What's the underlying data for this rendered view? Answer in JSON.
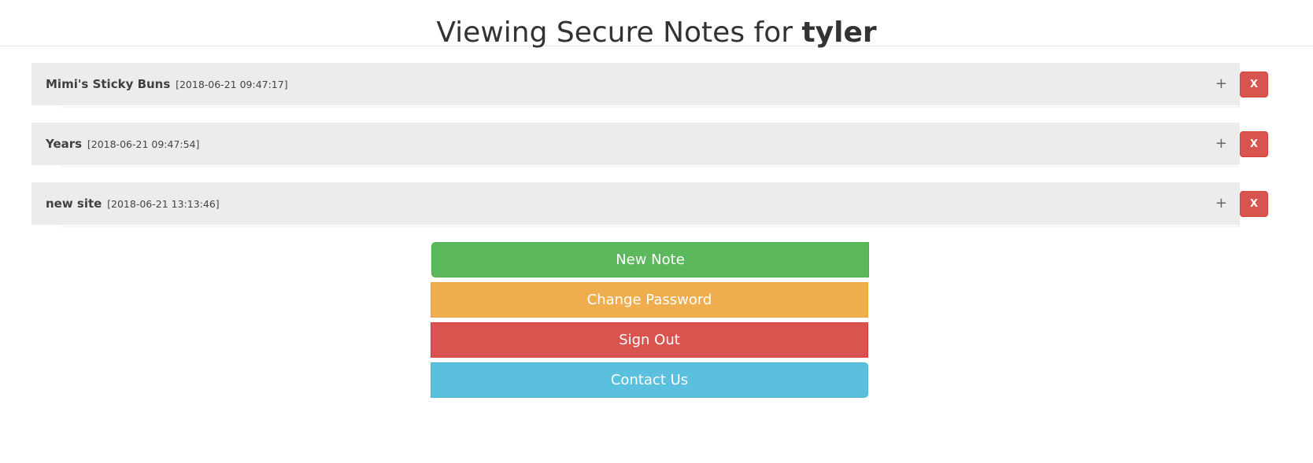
{
  "header": {
    "title_prefix": "Viewing Secure Notes for ",
    "username": "tyler"
  },
  "notes": [
    {
      "title": "Mimi's Sticky Buns",
      "date": "[2018-06-21 09:47:17]",
      "expand_icon": "+",
      "delete_label": "X"
    },
    {
      "title": "Years",
      "date": "[2018-06-21 09:47:54]",
      "expand_icon": "+",
      "delete_label": "X"
    },
    {
      "title": "new site",
      "date": "[2018-06-21 13:13:46]",
      "expand_icon": "+",
      "delete_label": "X"
    }
  ],
  "actions": {
    "new_note": "New Note",
    "change_password": "Change Password",
    "sign_out": "Sign Out",
    "contact_us": "Contact Us"
  },
  "colors": {
    "success": "#5cb85c",
    "warning": "#f0ad4e",
    "danger": "#d9534f",
    "info": "#5bc0de",
    "panel": "#ececec"
  }
}
